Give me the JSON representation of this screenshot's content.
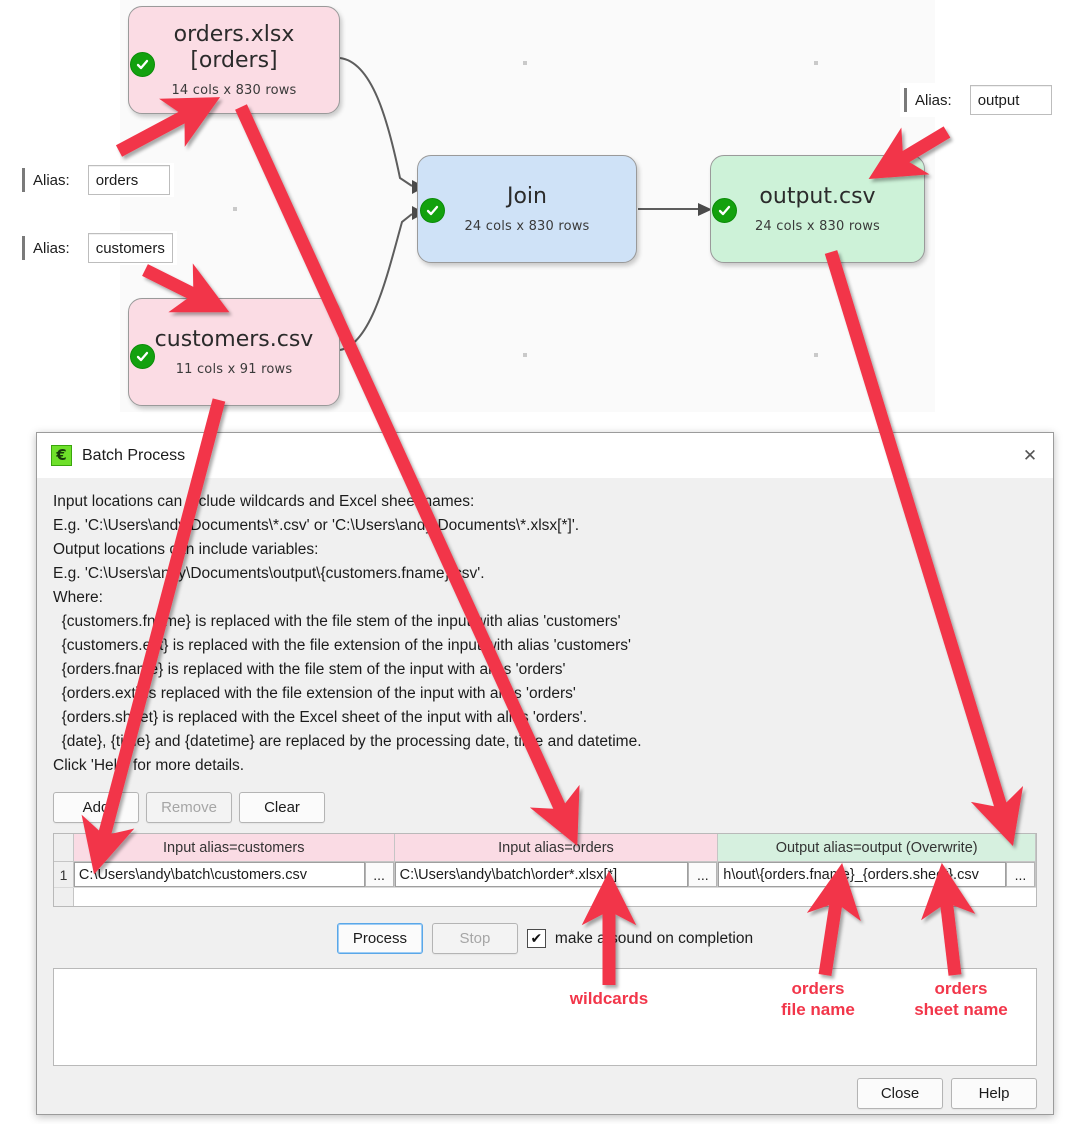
{
  "canvas": {
    "nodes": [
      {
        "id": "orders",
        "title": "orders.xlsx",
        "title2": "[orders]",
        "sub": "14 cols x 830 rows",
        "status": "ok-check-icon"
      },
      {
        "id": "customers",
        "title": "customers.csv",
        "title2": "",
        "sub": "11 cols x 91 rows",
        "status": "ok-check-icon"
      },
      {
        "id": "join",
        "title": "Join",
        "title2": "",
        "sub": "24 cols x 830 rows",
        "status": "ok-check-icon"
      },
      {
        "id": "output",
        "title": "output.csv",
        "title2": "",
        "sub": "24 cols x 830 rows",
        "status": "ok-check-icon"
      }
    ],
    "alias_fields": [
      {
        "label": "Alias:",
        "value": "orders"
      },
      {
        "label": "Alias:",
        "value": "customers"
      },
      {
        "label": "Alias:",
        "value": "output"
      }
    ]
  },
  "dialog": {
    "title": "Batch Process",
    "app_icon": "€",
    "close_icon": "✕",
    "help_lines": [
      "Input locations can include wildcards and Excel sheet names:",
      "E.g. 'C:\\Users\\andy\\Documents\\*.csv' or 'C:\\Users\\andy\\Documents\\*.xlsx[*]'.",
      "Output locations can include variables:",
      "E.g. 'C:\\Users\\andy\\Documents\\output\\{customers.fname}.csv'.",
      "Where:",
      "  {customers.fname} is replaced with the file stem of the input with alias 'customers'",
      "  {customers.ext} is replaced with the file extension of the input with alias 'customers'",
      "  {orders.fname} is replaced with the file stem of the input with alias 'orders'",
      "  {orders.ext} is replaced with the file extension of the input with alias 'orders'",
      "  {orders.sheet} is replaced with the Excel sheet of the input with alias 'orders'.",
      "  {date}, {time} and {datetime} are replaced by the processing date, time and datetime.",
      "Click 'Help' for more details."
    ],
    "toolbar": {
      "add_label": "Add",
      "remove_label": "Remove",
      "clear_label": "Clear"
    },
    "table": {
      "columns": [
        "Input alias=customers",
        "Input alias=orders",
        "Output alias=output (Overwrite)"
      ],
      "browse_label": "...",
      "rows": [
        {
          "num": "1",
          "cells": [
            "C:\\Users\\andy\\batch\\customers.csv",
            "C:\\Users\\andy\\batch\\order*.xlsx[*]",
            "h\\out\\{orders.fname}_{orders.sheet}.csv"
          ]
        }
      ]
    },
    "process_row": {
      "process_label": "Process",
      "stop_label": "Stop",
      "checkbox_mark": "✔",
      "checkbox_label": "make a sound on completion",
      "checkbox_checked": true
    },
    "footer": {
      "close_label": "Close",
      "help_label": "Help"
    }
  },
  "annotations": [
    {
      "id": "wildcards",
      "text": "wildcards"
    },
    {
      "id": "orders-file-name",
      "line1": "orders",
      "line2": "file name"
    },
    {
      "id": "orders-sheet-name",
      "line1": "orders",
      "line2": "sheet name"
    }
  ],
  "colors": {
    "input_node": "#fbdce4",
    "transform_node": "#cfe2f7",
    "output_node": "#cdf2d8",
    "status_ok": "#13a10e",
    "annotation": "#f2364a"
  }
}
